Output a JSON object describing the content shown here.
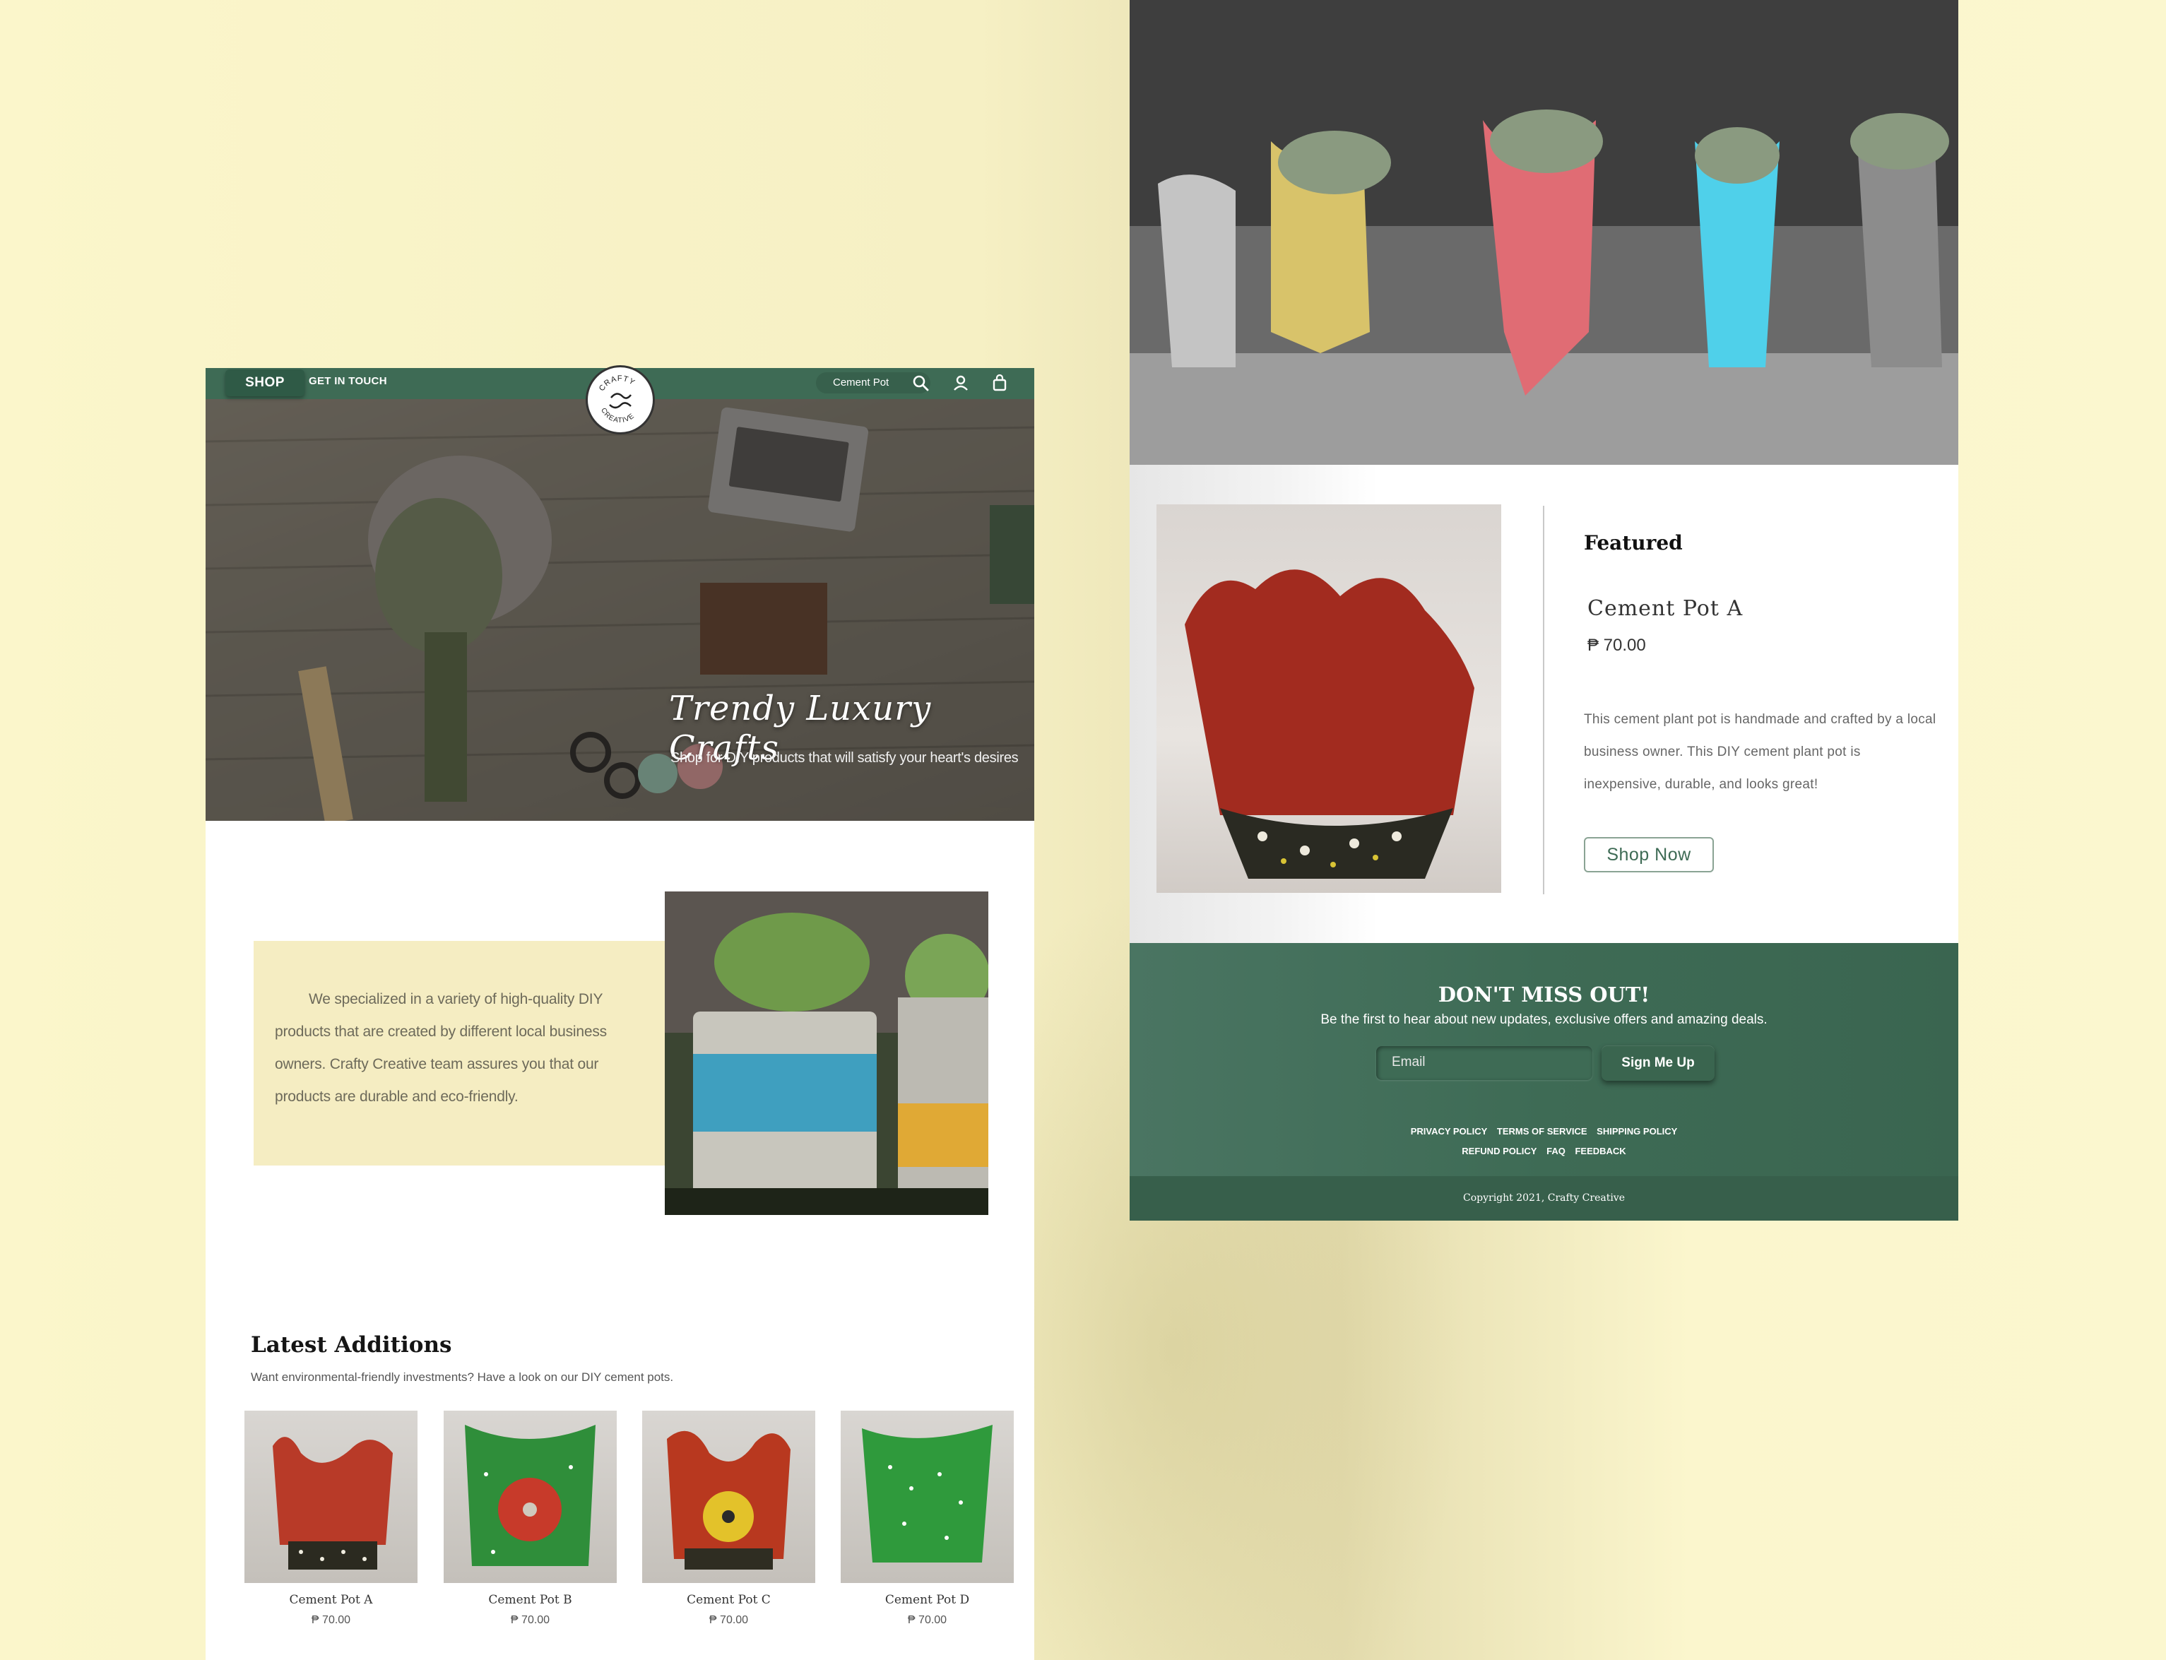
{
  "nav": {
    "shop_label": "SHOP",
    "contact_label": "GET IN TOUCH",
    "search_value": "Cement Pot",
    "logo_text_top": "CRAFTY",
    "logo_text_bottom": "CREATIVE"
  },
  "hero": {
    "title": "Trendy Luxury Crafts",
    "subtitle": "Shop for DIY products that will satisfy your heart's desires"
  },
  "about": {
    "text": "We specialized in a variety of high-quality DIY products that are created by different local business owners. Crafty Creative team assures you that our products are durable and eco-friendly."
  },
  "latest": {
    "title": "Latest Additions",
    "subtitle": "Want environmental-friendly investments? Have a look on our DIY cement pots.",
    "products": [
      {
        "name": "Cement Pot A",
        "price": "₱ 70.00"
      },
      {
        "name": "Cement Pot B",
        "price": "₱ 70.00"
      },
      {
        "name": "Cement Pot C",
        "price": "₱ 70.00"
      },
      {
        "name": "Cement Pot D",
        "price": "₱ 70.00"
      }
    ]
  },
  "featured": {
    "label": "Featured",
    "name": "Cement Pot A",
    "price": "₱ 70.00",
    "description": "This cement plant pot is handmade and crafted by a local business owner. This DIY cement plant pot is inexpensive, durable, and looks great!",
    "button_label": "Shop Now"
  },
  "newsletter": {
    "title": "DON'T MISS OUT!",
    "subtitle": "Be the first to hear about new updates, exclusive offers and amazing deals.",
    "email_placeholder": "Email",
    "button_label": "Sign Me Up"
  },
  "footer": {
    "links_row1": [
      "PRIVACY POLICY",
      "TERMS OF SERVICE",
      "SHIPPING POLICY"
    ],
    "links_row2": [
      "REFUND POLICY",
      "FAQ",
      "FEEDBACK"
    ],
    "copyright": "Copyright 2021, Crafty Creative"
  },
  "colors": {
    "brand_green": "#3e6b55",
    "background_cream": "#fbf6cb",
    "about_box": "#f5edc2"
  },
  "icons": [
    "search-icon",
    "user-icon",
    "bag-icon"
  ]
}
